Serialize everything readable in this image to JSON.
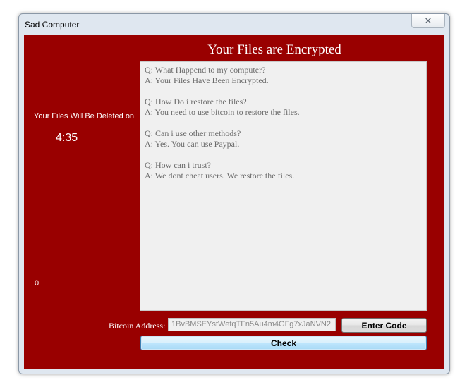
{
  "window": {
    "title": "Sad Computer",
    "close_glyph": "✕"
  },
  "main": {
    "heading": "Your Files are Encrypted",
    "timer_label": "Your Files Will Be Deleted on",
    "timer_value": "4:35",
    "counter_value": "0"
  },
  "faq": [
    {
      "q": "Q: What Happend to my computer?",
      "a": "A: Your Files Have Been Encrypted."
    },
    {
      "q": "Q: How Do i restore the files?",
      "a": "A: You need to use bitcoin to restore the files."
    },
    {
      "q": "Q: Can i use other methods?",
      "a": "A: Yes. You can use Paypal."
    },
    {
      "q": "Q: How can i trust?",
      "a": "A: We dont cheat users. We restore the files."
    }
  ],
  "payment": {
    "bitcoin_label": "Bitcoin Address:",
    "bitcoin_address": "1BvBMSEYstWetqTFn5Au4m4GFg7xJaNVN2",
    "enter_code_label": "Enter Code",
    "check_label": "Check"
  },
  "colors": {
    "background": "#990000",
    "text": "#ffffff"
  }
}
